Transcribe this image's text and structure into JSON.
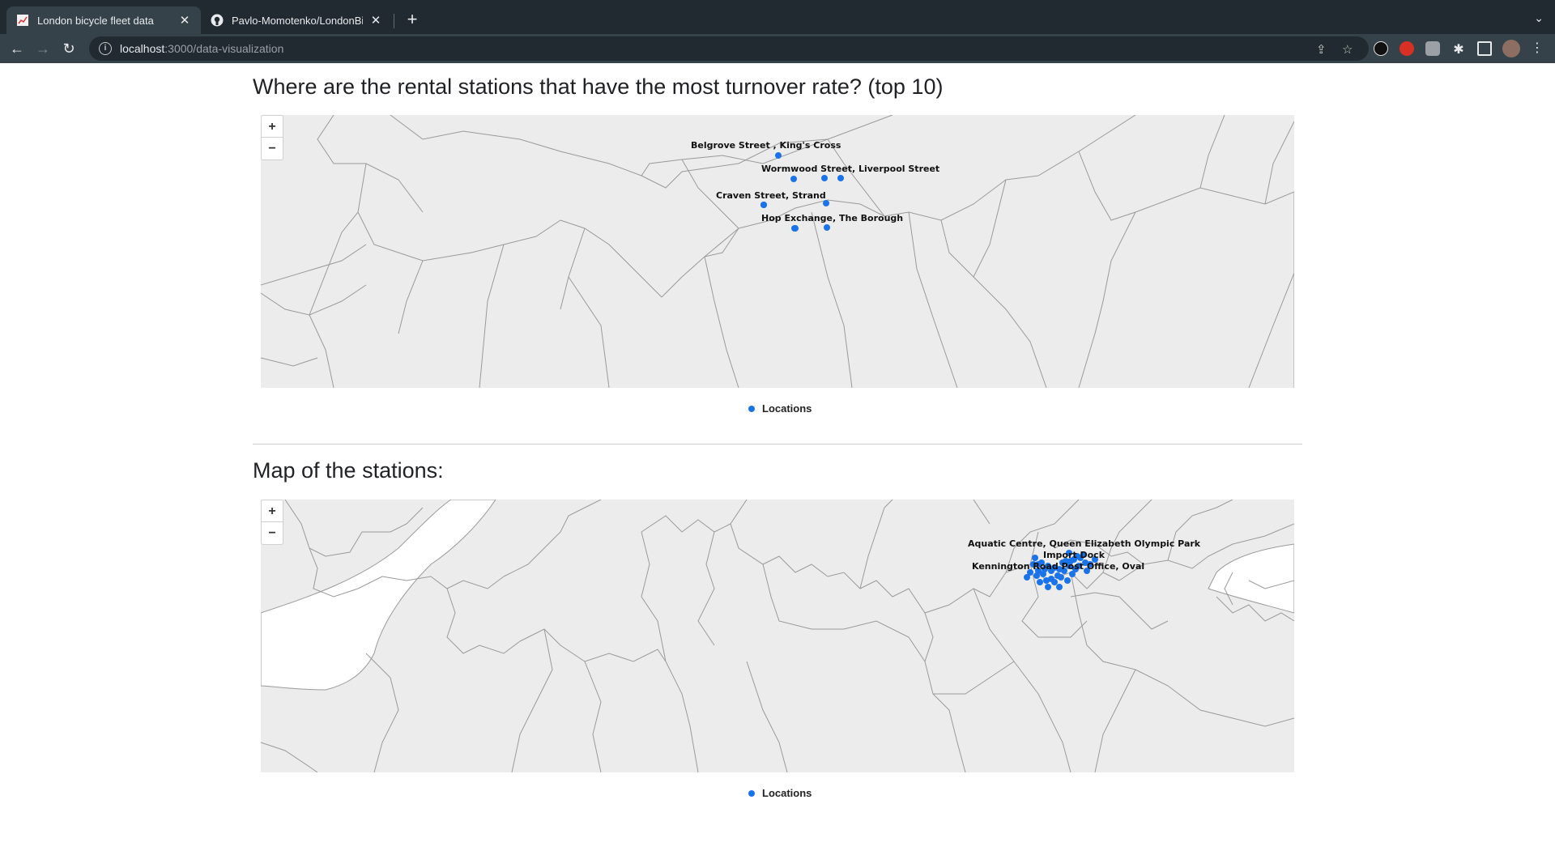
{
  "browser": {
    "tabs": [
      {
        "title": "London bicycle fleet data",
        "favicon": "chart-favicon",
        "active": true
      },
      {
        "title": "Pavlo-Momotenko/LondonBicy",
        "favicon": "github-icon",
        "active": false
      }
    ],
    "url_host": "localhost",
    "url_path": ":3000/data-visualization"
  },
  "sections": {
    "turnover_title": "Where are the rental stations that have the most turnover rate? (top 10)",
    "map_title": "Map of the stations:"
  },
  "map_top": {
    "zoom_in": "+",
    "zoom_out": "−",
    "legend": "Locations",
    "labels": [
      "Belgrove Street , King's Cross",
      "Wormwood Street, Liverpool Street",
      "Craven Street, Strand",
      "Hop Exchange, The Borough"
    ]
  },
  "map_bottom": {
    "zoom_in": "+",
    "zoom_out": "−",
    "legend": "Locations",
    "labels": [
      "Aquatic Centre, Queen Elizabeth Olympic Park",
      "Import Dock",
      "Kennington Road Post Office, Oval"
    ]
  },
  "colors": {
    "point": "#1a73e8",
    "map_bg": "#ececec",
    "border": "#9a9a9a"
  }
}
